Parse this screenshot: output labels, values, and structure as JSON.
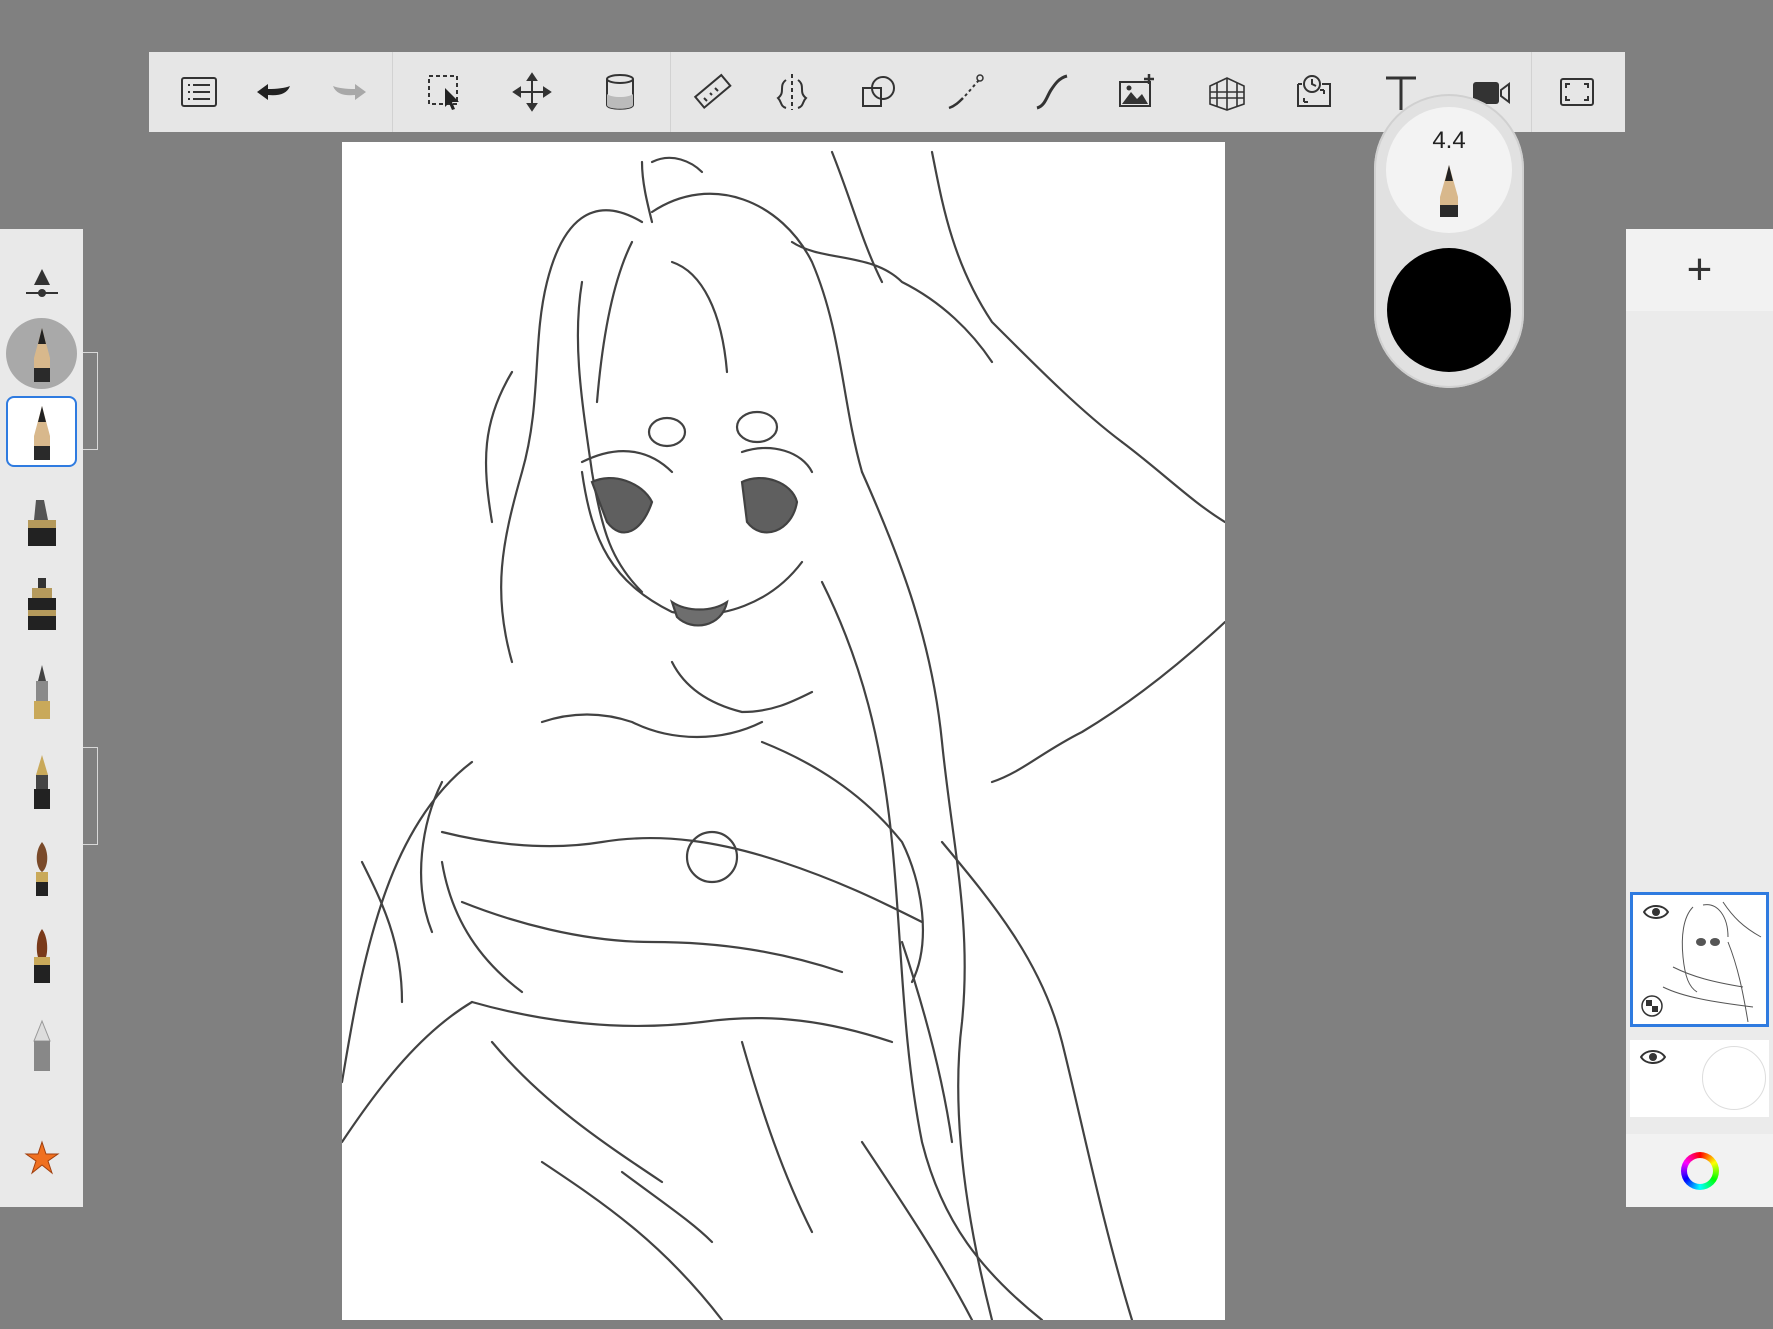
{
  "toolbar": {
    "items": [
      "menu-icon",
      "undo-icon",
      "redo-icon",
      "selection-icon",
      "transform-icon",
      "fill-icon",
      "ruler-icon",
      "symmetry-icon",
      "shape-icon",
      "stroke-icon",
      "curve-icon",
      "add-image-icon",
      "perspective-icon",
      "time-lapse-icon",
      "text-icon",
      "video-icon",
      "fullscreen-icon"
    ]
  },
  "brush": {
    "size_value": "4.4",
    "color": "#000000"
  },
  "tools": {
    "items": [
      "brush-settings-icon",
      "pencil-brush",
      "pencil-brush-selected",
      "marker-brush",
      "inkpen-brush",
      "fineliner-brush",
      "fountain-pen-brush",
      "paint-brush",
      "marker-brush-brown",
      "eraser-brush",
      "favorites-icon"
    ],
    "accent": "#2f7be0",
    "favorite_color": "#f07020"
  },
  "layers": {
    "add_label": "+",
    "items": [
      "layer-1",
      "layer-2"
    ]
  }
}
